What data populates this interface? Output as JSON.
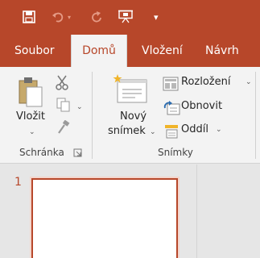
{
  "colors": {
    "accent": "#b7472a",
    "ribbon": "#f3f3f3",
    "pane": "#e6e6e6"
  },
  "quick_access": [
    {
      "icon": "save-icon"
    },
    {
      "icon": "undo-icon"
    },
    {
      "icon": "redo-icon"
    },
    {
      "icon": "present-icon"
    },
    {
      "icon": "customize-toolbar-icon",
      "glyph": "▾"
    }
  ],
  "tabs": [
    {
      "label": "Soubor",
      "active": false
    },
    {
      "label": "Domů",
      "active": true
    },
    {
      "label": "Vložení",
      "active": false
    },
    {
      "label": "Návrh",
      "active": false
    }
  ],
  "clipboard": {
    "paste_label": "Vložit",
    "group_label": "Schránka"
  },
  "slides": {
    "new_slide_line1": "Nový",
    "new_slide_line2": "snímek",
    "layout_label": "Rozložení",
    "reset_label": "Obnovit",
    "section_label": "Oddíl",
    "group_label": "Snímky"
  },
  "thumbnail": {
    "number": "1"
  }
}
